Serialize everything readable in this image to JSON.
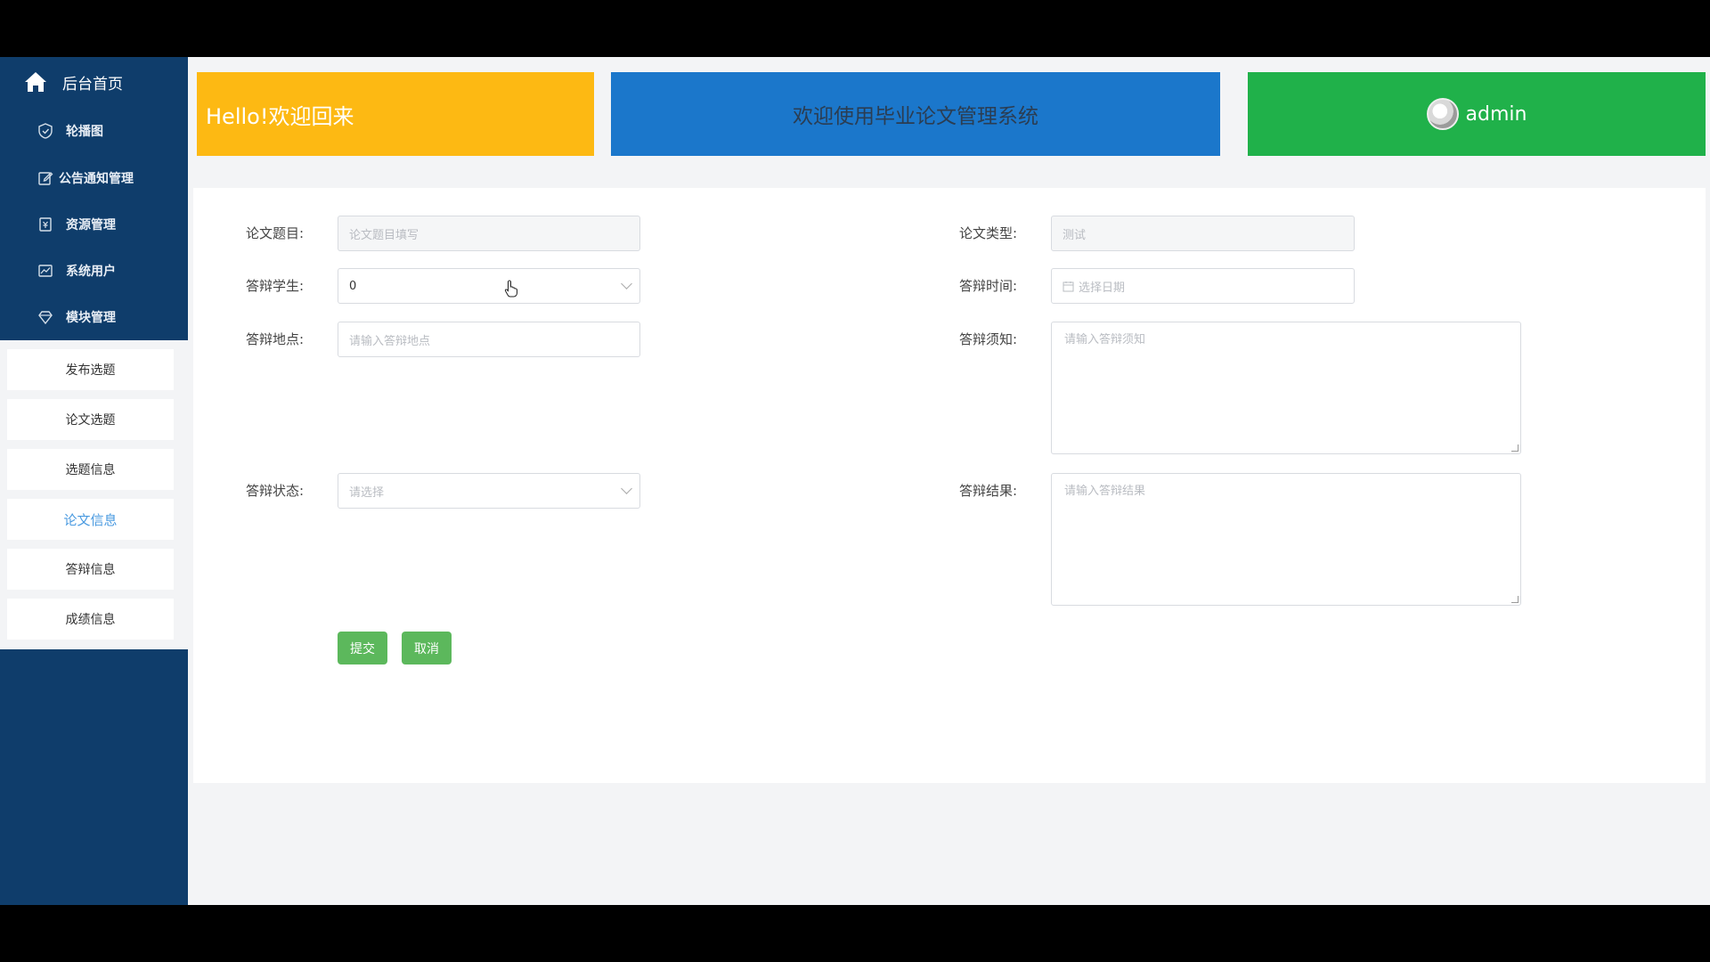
{
  "sidebar": {
    "home_label": "后台首页",
    "items": [
      {
        "label": "轮播图",
        "icon": "shield-icon"
      },
      {
        "label": "公告通知管理",
        "icon": "edit-icon"
      },
      {
        "label": "资源管理",
        "icon": "document-icon"
      },
      {
        "label": "系统用户",
        "icon": "chart-icon"
      },
      {
        "label": "模块管理",
        "icon": "diamond-icon"
      }
    ],
    "submenu": [
      {
        "label": "发布选题"
      },
      {
        "label": "论文选题"
      },
      {
        "label": "选题信息"
      },
      {
        "label": "论文信息",
        "active": true
      },
      {
        "label": "答辩信息"
      },
      {
        "label": "成绩信息"
      }
    ]
  },
  "header": {
    "welcome": "Hello!欢迎回来",
    "system_title": "欢迎使用毕业论文管理系统",
    "username": "admin"
  },
  "form": {
    "title_label": "论文题目:",
    "title_placeholder": "论文题目填写",
    "type_label": "论文类型:",
    "type_value": "测试",
    "student_label": "答辩学生:",
    "student_value": "0",
    "time_label": "答辩时间:",
    "time_placeholder": "选择日期",
    "location_label": "答辩地点:",
    "location_placeholder": "请输入答辩地点",
    "notice_label": "答辩须知:",
    "notice_placeholder": "请输入答辩须知",
    "status_label": "答辩状态:",
    "status_placeholder": "请选择",
    "result_label": "答辩结果:",
    "result_placeholder": "请输入答辩结果",
    "submit_label": "提交",
    "cancel_label": "取消"
  },
  "colors": {
    "sidebar_bg": "#0f3d6b",
    "welcome_card": "#fdb913",
    "title_card": "#1b77cb",
    "user_card": "#20b14a",
    "button": "#5cb85c",
    "active_menu": "#4a9ae0"
  }
}
